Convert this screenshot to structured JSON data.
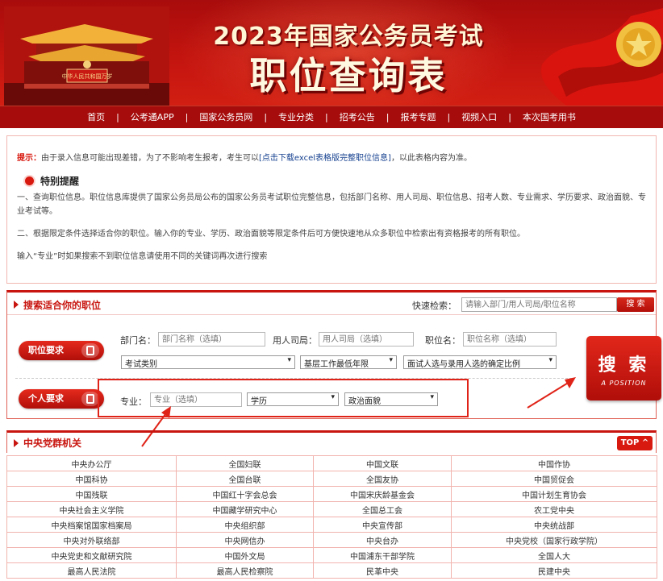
{
  "banner": {
    "title_line1": "2023年国家公务员考试",
    "title_line2": "职位查询表",
    "gate_sign": "中华人民共和国万岁"
  },
  "nav": [
    "首页",
    "公考通APP",
    "国家公务员网",
    "专业分类",
    "招考公告",
    "报考专题",
    "视频入口",
    "本次国考用书"
  ],
  "notice": {
    "tip_label": "提示：",
    "tip_text_1": "由于录入信息可能出现差错，为了不影响考生报考，考生可以",
    "tip_link": "[点击下载excel表格版完整职位信息]",
    "tip_text_2": "，以此表格内容为准。",
    "remind_title": "特别提醒",
    "p1": "一、查询职位信息。职位信息库提供了国家公务员局公布的国家公务员考试职位完整信息，包括部门名称、用人司局、职位信息、招考人数、专业需求、学历要求、政治面貌、专业考试等。",
    "p2": "二、根据限定条件选择适合你的职位。输入你的专业、学历、政治面貌等限定条件后可方便快速地从众多职位中检索出有资格报考的所有职位。",
    "p3": "输入“专业”时如果搜索不到职位信息请使用不同的关键词再次进行搜索"
  },
  "search": {
    "heading": "搜索适合你的职位",
    "quick_label": "快速检索：",
    "quick_placeholder": "请输入部门/用人司局/职位名称",
    "quick_button": "搜 索",
    "badge_job": "职位要求",
    "badge_person": "个人要求",
    "dept_label": "部门名：",
    "dept_placeholder": "部门名称（选填）",
    "bureau_label": "用人司局：",
    "bureau_placeholder": "用人司局（选填）",
    "position_label": "职位名：",
    "position_placeholder": "职位名称（选填）",
    "select_exam": "考试类别",
    "select_years": "基层工作最低年限",
    "select_ratio": "面试人选与录用人选的确定比例",
    "major_label": "专业：",
    "major_placeholder": "专业（选填）",
    "select_edu": "学历",
    "select_politics": "政治面貌",
    "big_button_main": "搜 索",
    "big_button_sub": "A POSITION"
  },
  "org": {
    "heading": "中央党群机关",
    "top_button": "TOP ^",
    "rows": [
      [
        "中央办公厅",
        "全国妇联",
        "中国文联",
        "中国作协"
      ],
      [
        "中国科协",
        "全国台联",
        "全国友协",
        "中国贸促会"
      ],
      [
        "中国残联",
        "中国红十字会总会",
        "中国宋庆龄基金会",
        "中国计划生育协会"
      ],
      [
        "中央社会主义学院",
        "中国藏学研究中心",
        "全国总工会",
        "农工党中央"
      ],
      [
        "中央档案馆国家档案局",
        "中央组织部",
        "中央宣传部",
        "中央统战部"
      ],
      [
        "中央对外联络部",
        "中央网信办",
        "中央台办",
        "中央党校（国家行政学院）"
      ],
      [
        "中央党史和文献研究院",
        "中国外文局",
        "中国浦东干部学院",
        "全国人大"
      ],
      [
        "最高人民法院",
        "最高人民检察院",
        "民革中央",
        "民建中央"
      ]
    ]
  },
  "colors": {
    "brand_red": "#c8150f",
    "nav_red": "#a60c0c",
    "link_blue": "#15408f"
  }
}
